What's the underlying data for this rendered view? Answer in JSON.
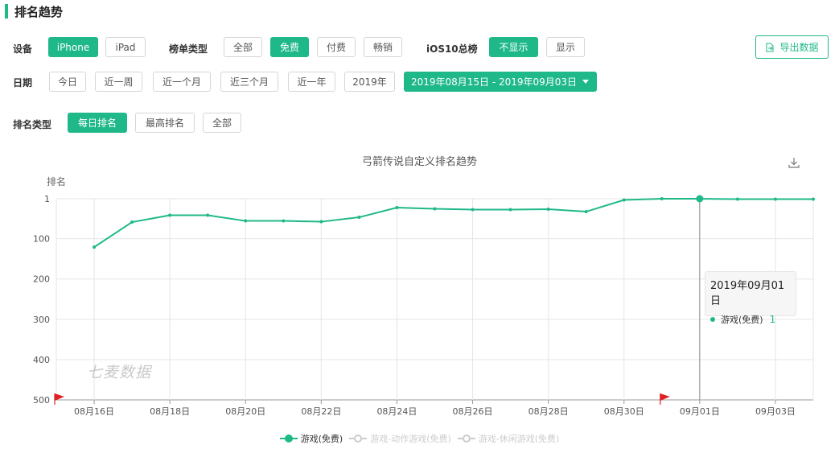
{
  "section_title": "排名趋势",
  "filters": {
    "device_label": "设备",
    "device_options": [
      "iPhone",
      "iPad"
    ],
    "list_type_label": "榜单类型",
    "list_type_options": [
      "全部",
      "免费",
      "付费",
      "畅销"
    ],
    "ios10_label": "iOS10总榜",
    "ios10_options": [
      "不显示",
      "显示"
    ],
    "export_label": "导出数据",
    "date_label": "日期",
    "date_options": [
      "今日",
      "近一周",
      "近一个月",
      "近三个月",
      "近一年",
      "2019年"
    ],
    "date_range": "2019年08月15日 - 2019年09月03日",
    "rank_type_label": "排名类型",
    "rank_type_options": [
      "每日排名",
      "最高排名",
      "全部"
    ]
  },
  "colors": {
    "accent": "#1fb889",
    "disabled": "#cccccc",
    "flag": "#e02020"
  },
  "watermark": "七麦数据",
  "tooltip": {
    "date": "2019年09月01日",
    "series": "游戏(免费)",
    "value": "1"
  },
  "chart_data": {
    "type": "line",
    "title": "弓箭传说自定义排名趋势",
    "ylabel": "排名",
    "y_inverted": true,
    "ylim": [
      1,
      500
    ],
    "yticks": [
      1,
      100,
      200,
      300,
      400,
      500
    ],
    "x": [
      "08月15日",
      "08月16日",
      "08月17日",
      "08月18日",
      "08月19日",
      "08月20日",
      "08月21日",
      "08月22日",
      "08月23日",
      "08月24日",
      "08月25日",
      "08月26日",
      "08月27日",
      "08月28日",
      "08月29日",
      "08月30日",
      "08月31日",
      "09月01日",
      "09月02日",
      "09月03日",
      "09月04日"
    ],
    "xtick_labels": [
      "08月16日",
      "08月18日",
      "08月20日",
      "08月22日",
      "08月24日",
      "08月26日",
      "08月28日",
      "08月30日",
      "09月01日",
      "09月03日"
    ],
    "series": [
      {
        "name": "游戏(免费)",
        "color": "#1fb889",
        "active": true,
        "values": [
          null,
          121,
          59,
          42,
          42,
          56,
          56,
          58,
          47,
          23,
          26,
          28,
          28,
          27,
          33,
          4,
          1,
          1,
          2,
          2,
          2
        ]
      },
      {
        "name": "游戏-动作游戏(免费)",
        "color": "#cccccc",
        "active": false,
        "values": []
      },
      {
        "name": "游戏-休闲游戏(免费)",
        "color": "#cccccc",
        "active": false,
        "values": []
      }
    ],
    "highlight_x": "09月01日",
    "flags_x": [
      "08月15日",
      "08月31日"
    ],
    "grid": true
  }
}
